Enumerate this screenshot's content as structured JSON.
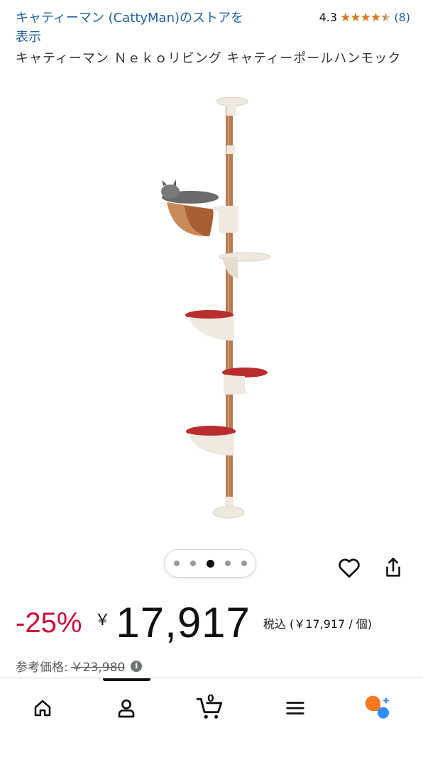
{
  "header": {
    "store_link": "キャティーマン (CattyMan)のストアを表示",
    "rating_value": "4.3",
    "rating_stars": 4.3,
    "rating_count": "(8)",
    "title": "キャティーマン Ｎｅｋｏリビング キャティーポールハンモック"
  },
  "gallery": {
    "image_icon": "cat-tree-pole-image",
    "dot_count": 5,
    "active_index": 2
  },
  "actions": {
    "wishlist_icon": "heart-icon",
    "share_icon": "share-icon"
  },
  "pricing": {
    "discount": "-25%",
    "currency": "￥",
    "price": "17,917",
    "tax_note": "税込 (￥17,917 / 個)",
    "reference_label": "参考価格:",
    "reference_price": "￥23,980",
    "discount_color": "#cc0c39"
  },
  "bottom_nav": {
    "items": [
      "home-icon",
      "account-icon",
      "cart-icon",
      "menu-icon",
      "rufus-icon"
    ],
    "cart_count": "0",
    "active_index": 1
  }
}
